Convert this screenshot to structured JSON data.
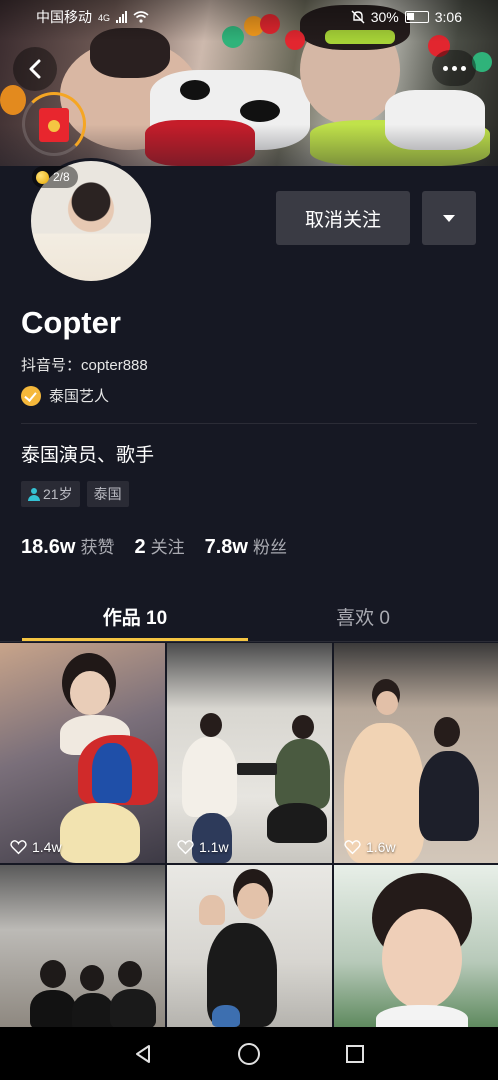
{
  "status_bar": {
    "carrier": "中国移动",
    "network": "4G",
    "battery": "30%",
    "time": "3:06"
  },
  "header": {
    "coins": "2/8"
  },
  "profile": {
    "follow_button": "取消关注",
    "name": "Copter",
    "douyin_id": "抖音号：copter888",
    "verification": "泰国艺人",
    "bio": "泰国演员、歌手",
    "tags": [
      "21岁",
      "泰国"
    ]
  },
  "stats": [
    {
      "value": "18.6w",
      "label": "获赞"
    },
    {
      "value": "2",
      "label": "关注"
    },
    {
      "value": "7.8w",
      "label": "粉丝"
    }
  ],
  "tabs": {
    "works": "作品 10",
    "likes": "喜欢 0"
  },
  "videos": [
    {
      "likes": "1.4w"
    },
    {
      "likes": "1.1w"
    },
    {
      "likes": "1.6w"
    },
    {
      "likes": ""
    },
    {
      "likes": ""
    },
    {
      "likes": ""
    }
  ],
  "colors": {
    "background": "#161823",
    "accent": "#f5c542",
    "button": "#3a3b44",
    "verify": "#f5b83b"
  }
}
